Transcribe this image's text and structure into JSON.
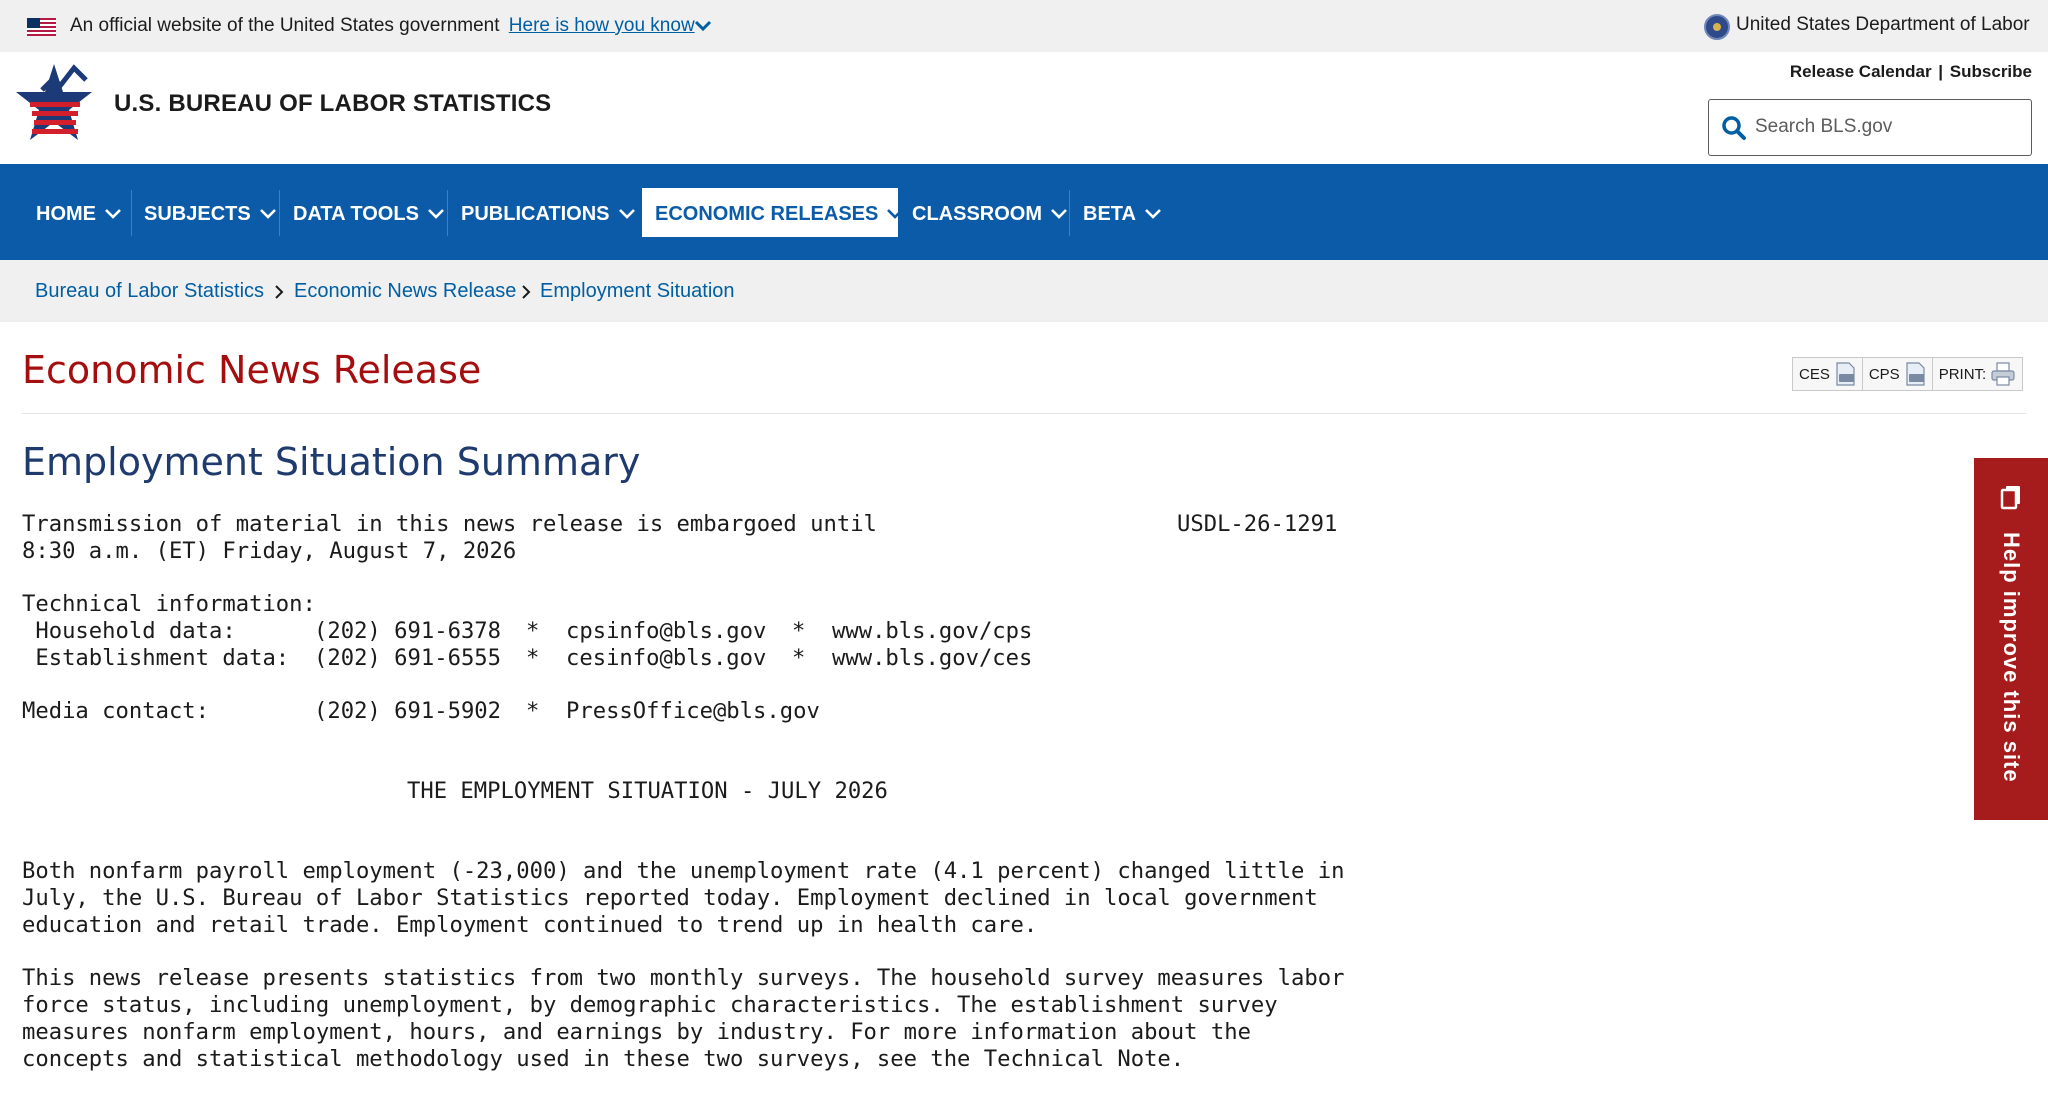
{
  "gov_banner": {
    "text": "An official website of the United States government",
    "link": "Here is how you know",
    "dol": "United States Department of Labor"
  },
  "header": {
    "site_title": "U.S. BUREAU OF LABOR STATISTICS",
    "release_calendar": "Release Calendar",
    "separator": "|",
    "subscribe": "Subscribe",
    "search_placeholder": "Search BLS.gov"
  },
  "nav": {
    "items": [
      {
        "label": "HOME"
      },
      {
        "label": "SUBJECTS"
      },
      {
        "label": "DATA TOOLS"
      },
      {
        "label": "PUBLICATIONS"
      },
      {
        "label": "ECONOMIC RELEASES",
        "active": true
      },
      {
        "label": "CLASSROOM"
      },
      {
        "label": "BETA"
      }
    ]
  },
  "breadcrumb": [
    "Bureau of Labor Statistics",
    "Economic News Release",
    "Employment Situation"
  ],
  "page": {
    "title": "Economic News Release",
    "tools": {
      "ces": "CES",
      "cps": "CPS",
      "print": "PRINT:"
    },
    "section_title": "Employment Situation Summary"
  },
  "release": {
    "embargo_line1": "Transmission of material in this news release is embargoed until",
    "release_id": "USDL-26-1291",
    "embargo_line2": "8:30 a.m. (ET) Friday, August 7, 2026",
    "tech_info": "Technical information:",
    "household": {
      "label": " Household data:",
      "phone": "(202) 691-6378",
      "email": "cpsinfo@bls.gov",
      "url": "www.bls.gov/cps"
    },
    "establishment": {
      "label": " Establishment data:",
      "phone": "(202) 691-6555",
      "email": "cesinfo@bls.gov",
      "url": "www.bls.gov/ces"
    },
    "media": {
      "label": "Media contact:",
      "phone": "(202) 691-5902",
      "email": "PressOffice@bls.gov"
    },
    "star": "*",
    "headline": "THE EMPLOYMENT SITUATION - JULY 2026",
    "para1": [
      "Both nonfarm payroll employment (-23,000) and the unemployment rate (4.1 percent) changed little in",
      "July, the U.S. Bureau of Labor Statistics reported today. Employment declined in local government",
      "education and retail trade. Employment continued to trend up in health care."
    ],
    "para2": [
      "This news release presents statistics from two monthly surveys. The household survey measures labor",
      "force status, including unemployment, by demographic characteristics. The establishment survey",
      "measures nonfarm employment, hours, and earnings by industry. For more information about the",
      "concepts and statistical methodology used in these two surveys, see the Technical Note."
    ]
  },
  "feedback": {
    "label": "Help improve this site"
  },
  "colors": {
    "nav_blue": "#0b5ba8",
    "title_red": "#a50e0e",
    "section_navy": "#1f3b6e",
    "link_blue": "#005ea2",
    "feedback_red": "#a61b1b"
  }
}
